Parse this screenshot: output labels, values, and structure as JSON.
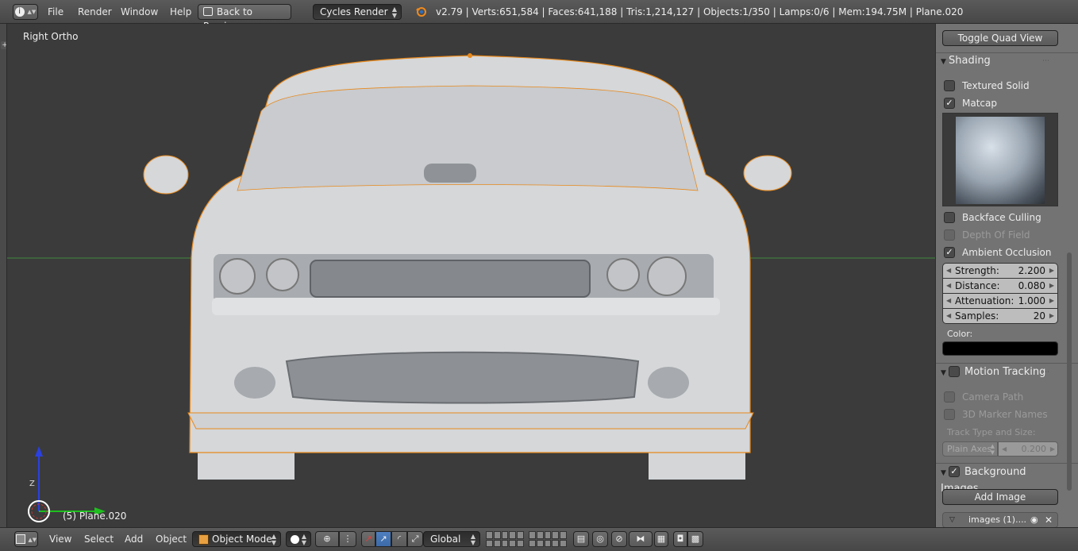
{
  "topbar": {
    "info_icon": "info-icon",
    "menu": [
      "File",
      "Render",
      "Window",
      "Help"
    ],
    "back_button": "Back to Previous",
    "render_engine": "Cycles Render",
    "stats": "v2.79 | Verts:651,584 | Faces:641,188 | Tris:1,214,127 | Objects:1/350 | Lamps:0/6 | Mem:194.75M | Plane.020"
  },
  "viewport": {
    "view_label": "Right Ortho",
    "object_label": "(5) Plane.020",
    "axis_z": "Z"
  },
  "panel": {
    "toggle_quad_view": "Toggle Quad View",
    "shading": {
      "title": "Shading",
      "textured_solid": {
        "label": "Textured Solid",
        "checked": false
      },
      "matcap": {
        "label": "Matcap",
        "checked": true
      },
      "backface_culling": {
        "label": "Backface Culling",
        "checked": false
      },
      "depth_of_field": {
        "label": "Depth Of Field",
        "checked": false,
        "disabled": true
      },
      "ambient_occlusion": {
        "label": "Ambient Occlusion",
        "checked": true
      },
      "strength": {
        "label": "Strength:",
        "value": "2.200"
      },
      "distance": {
        "label": "Distance:",
        "value": "0.080"
      },
      "attenuation": {
        "label": "Attenuation:",
        "value": "1.000"
      },
      "samples": {
        "label": "Samples:",
        "value": "20"
      },
      "color_label": "Color:",
      "color_value": "#000000"
    },
    "motion_tracking": {
      "title": "Motion Tracking",
      "camera_path": "Camera Path",
      "marker_names": "3D Marker Names",
      "track_type_label": "Track Type and Size:",
      "track_type": "Plain Axes",
      "track_size": "0.200"
    },
    "background_images": {
      "title": "Background Images",
      "add_image": "Add Image",
      "image_item": "images (1)...."
    }
  },
  "bottombar": {
    "menu": [
      "View",
      "Select",
      "Add",
      "Object"
    ],
    "mode": "Object Mode",
    "orientation": "Global"
  },
  "colors": {
    "selection_outline": "#e8891c",
    "horizon_line": "#3f8a3f",
    "axis_y": "#1fbf1f",
    "axis_z": "#2a40e0",
    "active_button": "#4f7fbf"
  }
}
